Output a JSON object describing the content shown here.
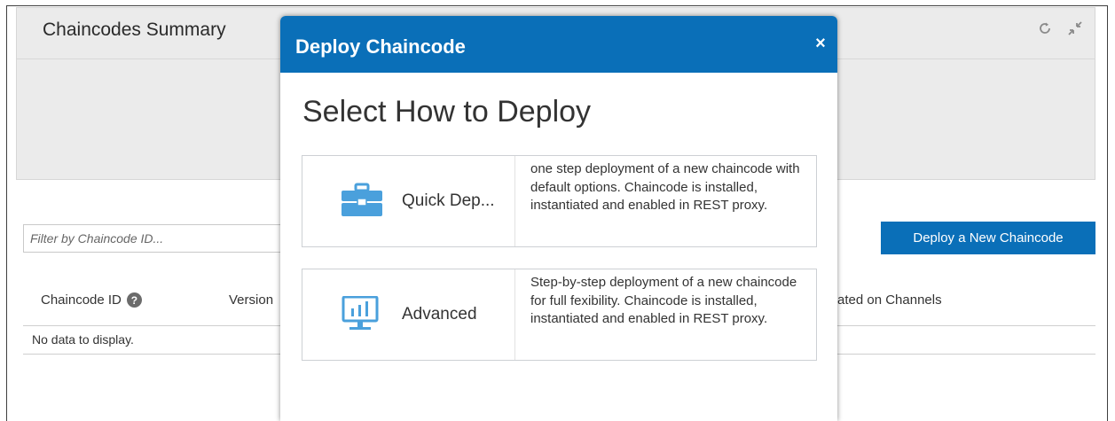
{
  "page": {
    "panel_title": "Chaincodes Summary",
    "filter_placeholder": "Filter by Chaincode ID...",
    "deploy_new_label": "Deploy a New Chaincode",
    "table": {
      "columns": [
        "Chaincode ID",
        "Version",
        "ated on Channels"
      ],
      "empty_message": "No data to display."
    },
    "icons": {
      "refresh": "refresh-icon",
      "collapse": "collapse-icon",
      "help": "help-icon"
    }
  },
  "modal": {
    "title": "Deploy Chaincode",
    "close_label": "×",
    "heading": "Select How to Deploy",
    "options": [
      {
        "label": "Quick Dep...",
        "icon": "briefcase-icon",
        "description": "one step deployment of a new chaincode with default options. Chaincode is installed, instantiated and enabled in REST proxy."
      },
      {
        "label": "Advanced",
        "icon": "monitor-chart-icon",
        "description": "Step-by-step deployment of a new chaincode for full fexibility. Chaincode is installed, instantiated and enabled in REST proxy."
      }
    ]
  },
  "colors": {
    "accent": "#0a6fb8",
    "icon_blue": "#4aa0dc",
    "panel_bg": "#ebebeb"
  }
}
